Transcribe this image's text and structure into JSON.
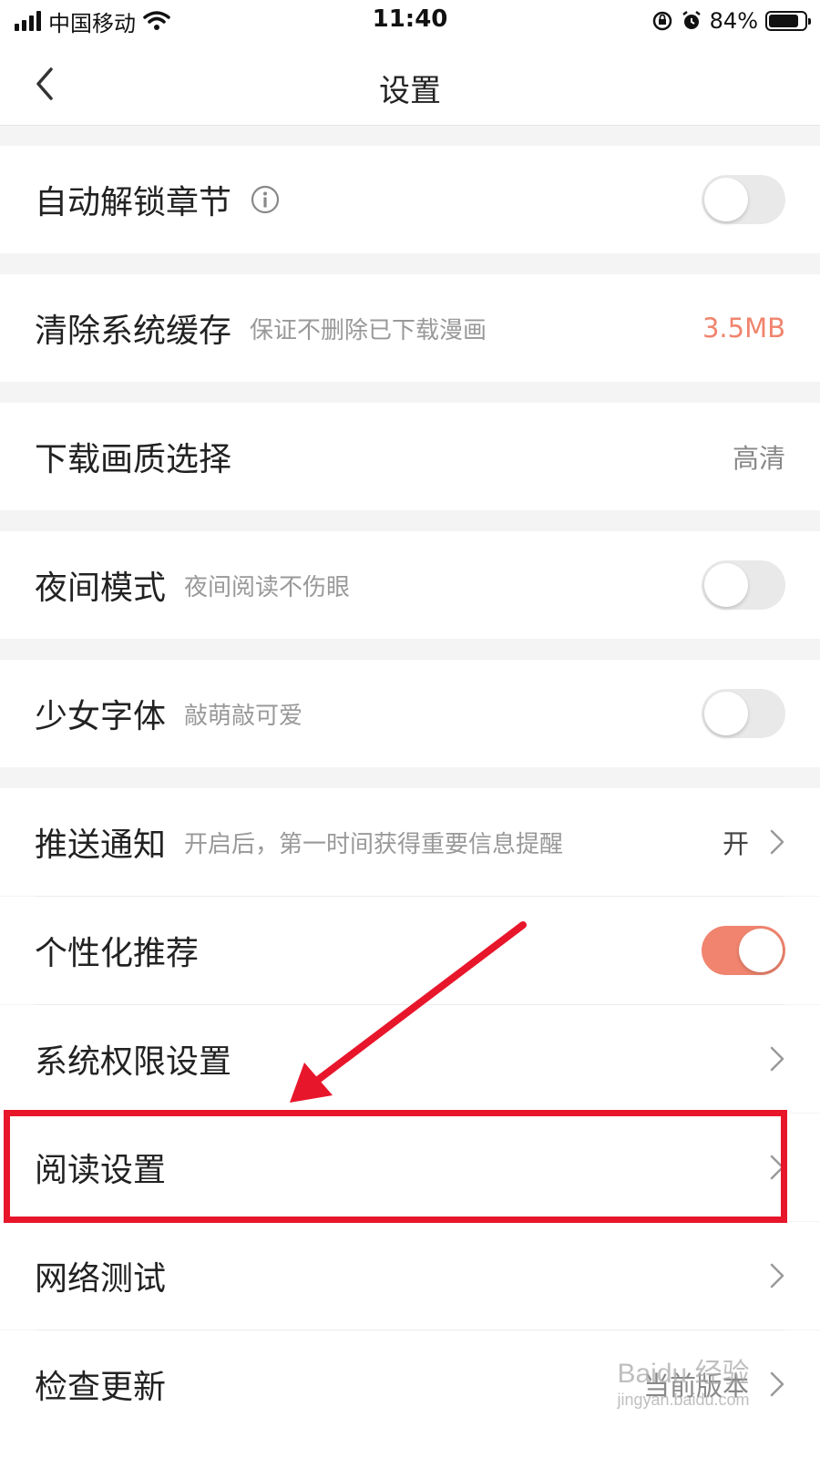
{
  "status_bar": {
    "carrier": "中国移动",
    "time": "11:40",
    "battery": "84%",
    "battery_level": 0.84
  },
  "nav": {
    "title": "设置",
    "back_icon": "chevron-left-icon"
  },
  "settings": {
    "auto_unlock": {
      "label": "自动解锁章节",
      "icon": "info-icon",
      "enabled": false
    },
    "clear_cache": {
      "label": "清除系统缓存",
      "sub": "保证不删除已下载漫画",
      "value": "3.5MB"
    },
    "download_quality": {
      "label": "下载画质选择",
      "value": "高清"
    },
    "night_mode": {
      "label": "夜间模式",
      "sub": "夜间阅读不伤眼",
      "enabled": false
    },
    "girl_font": {
      "label": "少女字体",
      "sub": "敲萌敲可爱",
      "enabled": false
    },
    "push_notify": {
      "label": "推送通知",
      "sub": "开启后，第一时间获得重要信息提醒",
      "value": "开"
    },
    "personalized": {
      "label": "个性化推荐",
      "enabled": true
    },
    "permissions": {
      "label": "系统权限设置"
    },
    "reading": {
      "label": "阅读设置"
    },
    "network_test": {
      "label": "网络测试"
    },
    "check_update": {
      "label": "检查更新",
      "value": "当前版本"
    }
  },
  "annotation": {
    "color": "#e8162b"
  },
  "watermark": {
    "line1": "Baidu 经验",
    "line2": "jingyan.baidu.com"
  },
  "colors": {
    "accent": "#f0846e",
    "toggle_off": "#e9e9e9",
    "background": "#f4f4f4"
  }
}
